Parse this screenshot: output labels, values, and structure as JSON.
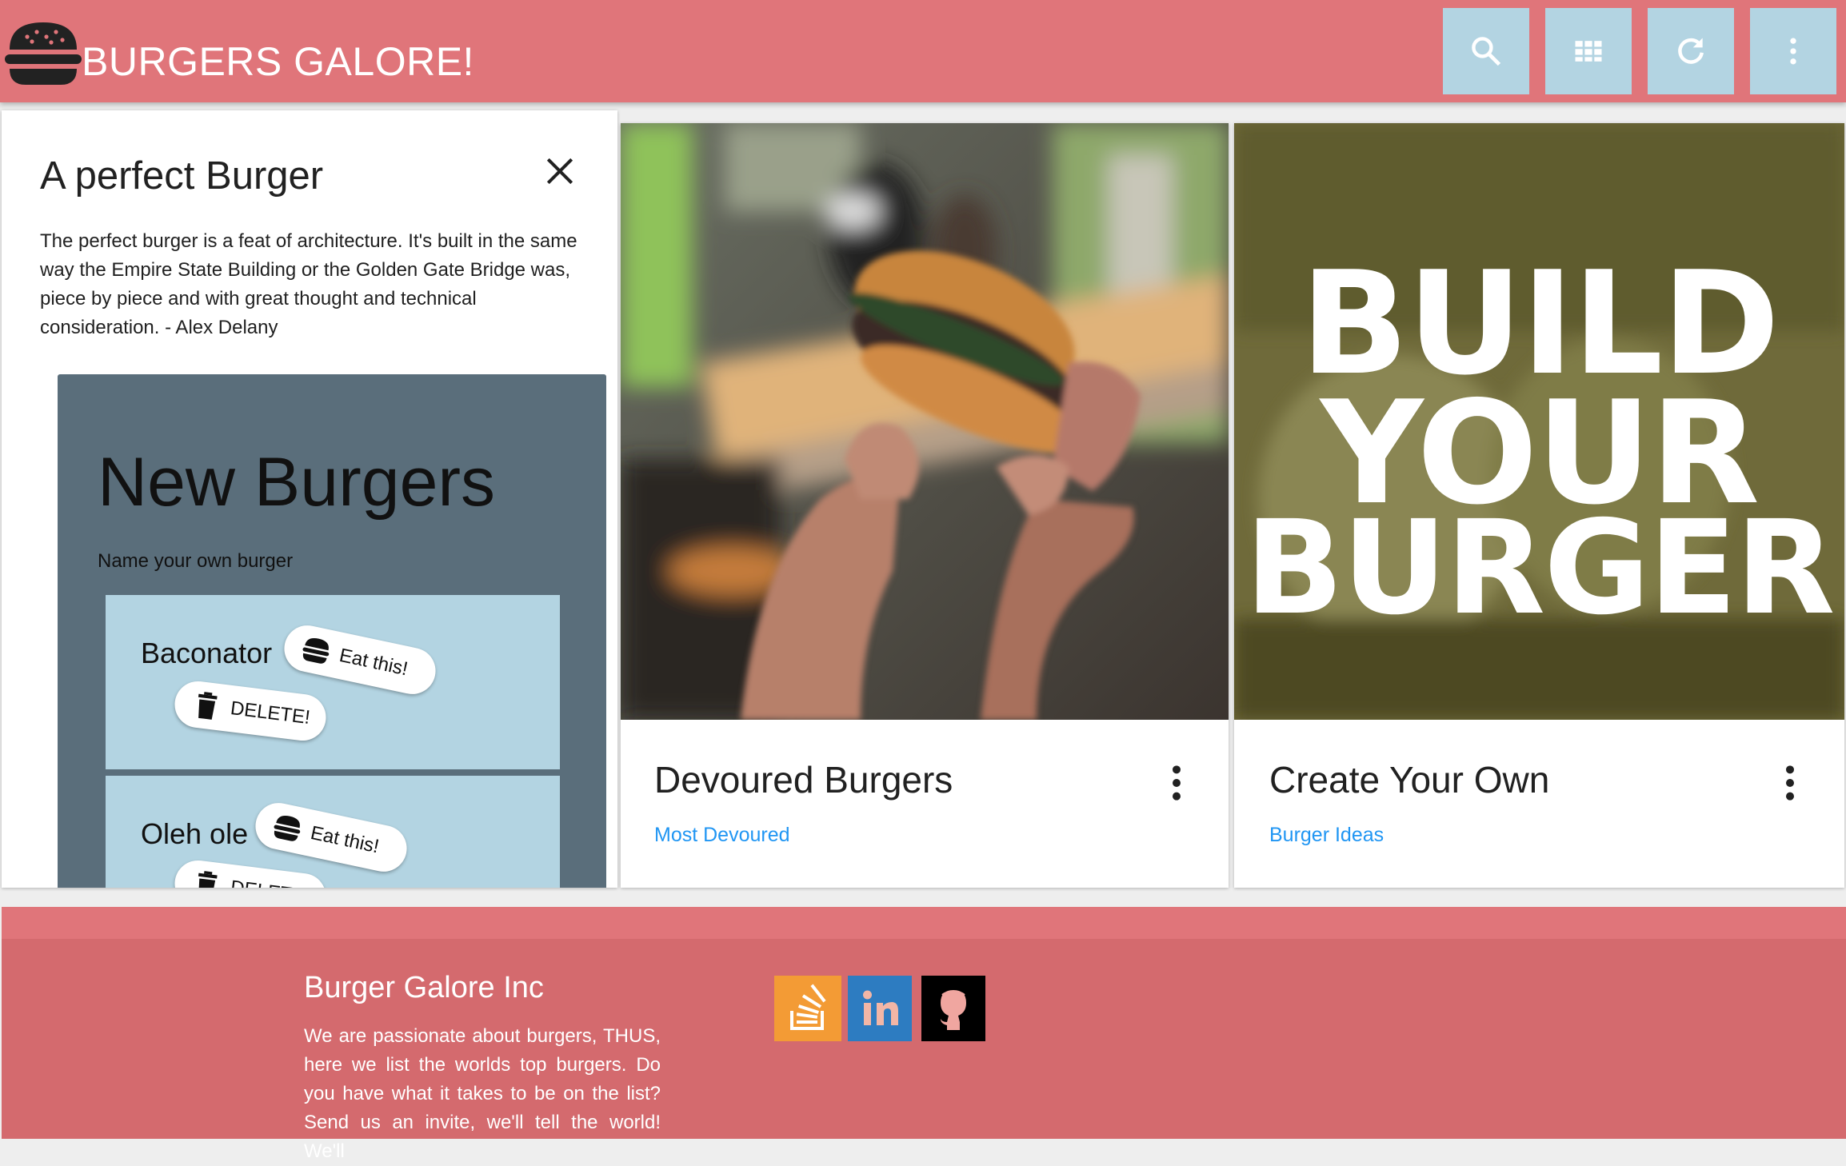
{
  "header": {
    "brand": "BURGERS GALORE!",
    "actions": [
      {
        "name": "search-button",
        "icon": "search-icon"
      },
      {
        "name": "grid-view-button",
        "icon": "grid-icon"
      },
      {
        "name": "refresh-button",
        "icon": "refresh-icon"
      },
      {
        "name": "more-menu-button",
        "icon": "more-vert-icon"
      }
    ],
    "colors": {
      "bar": "#e0757a",
      "button": "#b3d4e2"
    }
  },
  "reveal_card": {
    "title": "A perfect Burger",
    "quote": "The perfect burger is a feat of architecture. It's built in the same way the Empire State Building or the Golden Gate Bridge was, piece by piece and with great thought and technical consideration. - Alex Delany",
    "form": {
      "title": "New Burgers",
      "subtitle": "Name your own burger",
      "items": [
        {
          "name": "Baconator",
          "eat_label": "Eat this!",
          "delete_label": "DELETE!"
        },
        {
          "name": "Oleh ole",
          "eat_label": "Eat this!",
          "delete_label": "DELETE!"
        }
      ]
    }
  },
  "cards": [
    {
      "title": "Devoured Burgers",
      "link": "Most Devoured",
      "image": "burger-photo"
    },
    {
      "title": "Create Your Own",
      "link": "Burger Ideas",
      "image": "build-your-burger-poster",
      "poster_text": [
        "BUILD",
        "YOUR",
        "BURGER"
      ]
    }
  ],
  "footer": {
    "title": "Burger Galore Inc",
    "text": "We are passionate about burgers, THUS, here we list the worlds top burgers. Do you have what it takes to be on the list? Send us an invite, we'll tell the world! We'll",
    "social": [
      {
        "name": "stackoverflow",
        "color": "#f39b35"
      },
      {
        "name": "linkedin",
        "color": "#2d7cc1"
      },
      {
        "name": "github",
        "color": "#000000"
      }
    ]
  },
  "link_color": "#2196f3"
}
